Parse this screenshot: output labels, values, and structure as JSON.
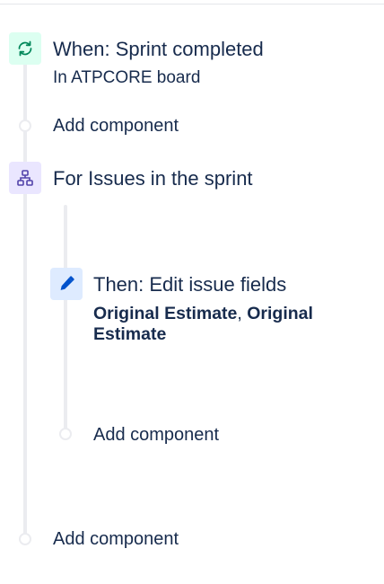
{
  "trigger": {
    "title": "When: Sprint completed",
    "subtitle": "In ATPCORE board",
    "icon": "refresh-trigger-icon",
    "color": "#00875a"
  },
  "add_component_1": "Add component",
  "branch": {
    "title": "For Issues in the sprint",
    "icon": "branch-hierarchy-icon",
    "color": "#5243aa"
  },
  "action": {
    "title": "Then: Edit issue fields",
    "field_1": "Original Estimate",
    "separator": ",",
    "field_2": "Original",
    "field_2_cont": "Estimate",
    "icon": "pencil-edit-icon",
    "color": "#0052cc"
  },
  "add_component_2": "Add component",
  "add_component_3": "Add component"
}
